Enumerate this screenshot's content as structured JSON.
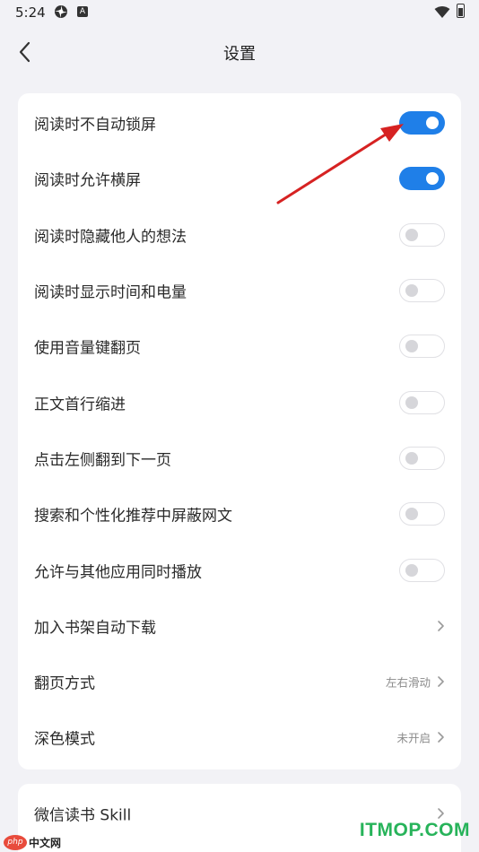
{
  "status_bar": {
    "time": "5:24"
  },
  "nav": {
    "title": "设置",
    "back_icon": "chevron-left-icon"
  },
  "settings": [
    {
      "label": "阅读时不自动锁屏",
      "type": "toggle",
      "on": true
    },
    {
      "label": "阅读时允许横屏",
      "type": "toggle",
      "on": true
    },
    {
      "label": "阅读时隐藏他人的想法",
      "type": "toggle",
      "on": false
    },
    {
      "label": "阅读时显示时间和电量",
      "type": "toggle",
      "on": false
    },
    {
      "label": "使用音量键翻页",
      "type": "toggle",
      "on": false
    },
    {
      "label": "正文首行缩进",
      "type": "toggle",
      "on": false
    },
    {
      "label": "点击左侧翻到下一页",
      "type": "toggle",
      "on": false
    },
    {
      "label": "搜索和个性化推荐中屏蔽网文",
      "type": "toggle",
      "on": false
    },
    {
      "label": "允许与其他应用同时播放",
      "type": "toggle",
      "on": false
    },
    {
      "label": "加入书架自动下载",
      "type": "link",
      "value": ""
    },
    {
      "label": "翻页方式",
      "type": "link",
      "value": "左右滑动"
    },
    {
      "label": "深色模式",
      "type": "link",
      "value": "未开启"
    }
  ],
  "more": [
    {
      "label": "微信读书 Skill",
      "type": "link",
      "value": ""
    }
  ],
  "colors": {
    "toggle_on": "#1f7fe8",
    "annotation_arrow": "#d62222",
    "watermark_green": "#27b35a"
  },
  "watermarks": {
    "left_badge": "php",
    "left_text": "中文网",
    "right_text": "ITMOP.COM"
  }
}
